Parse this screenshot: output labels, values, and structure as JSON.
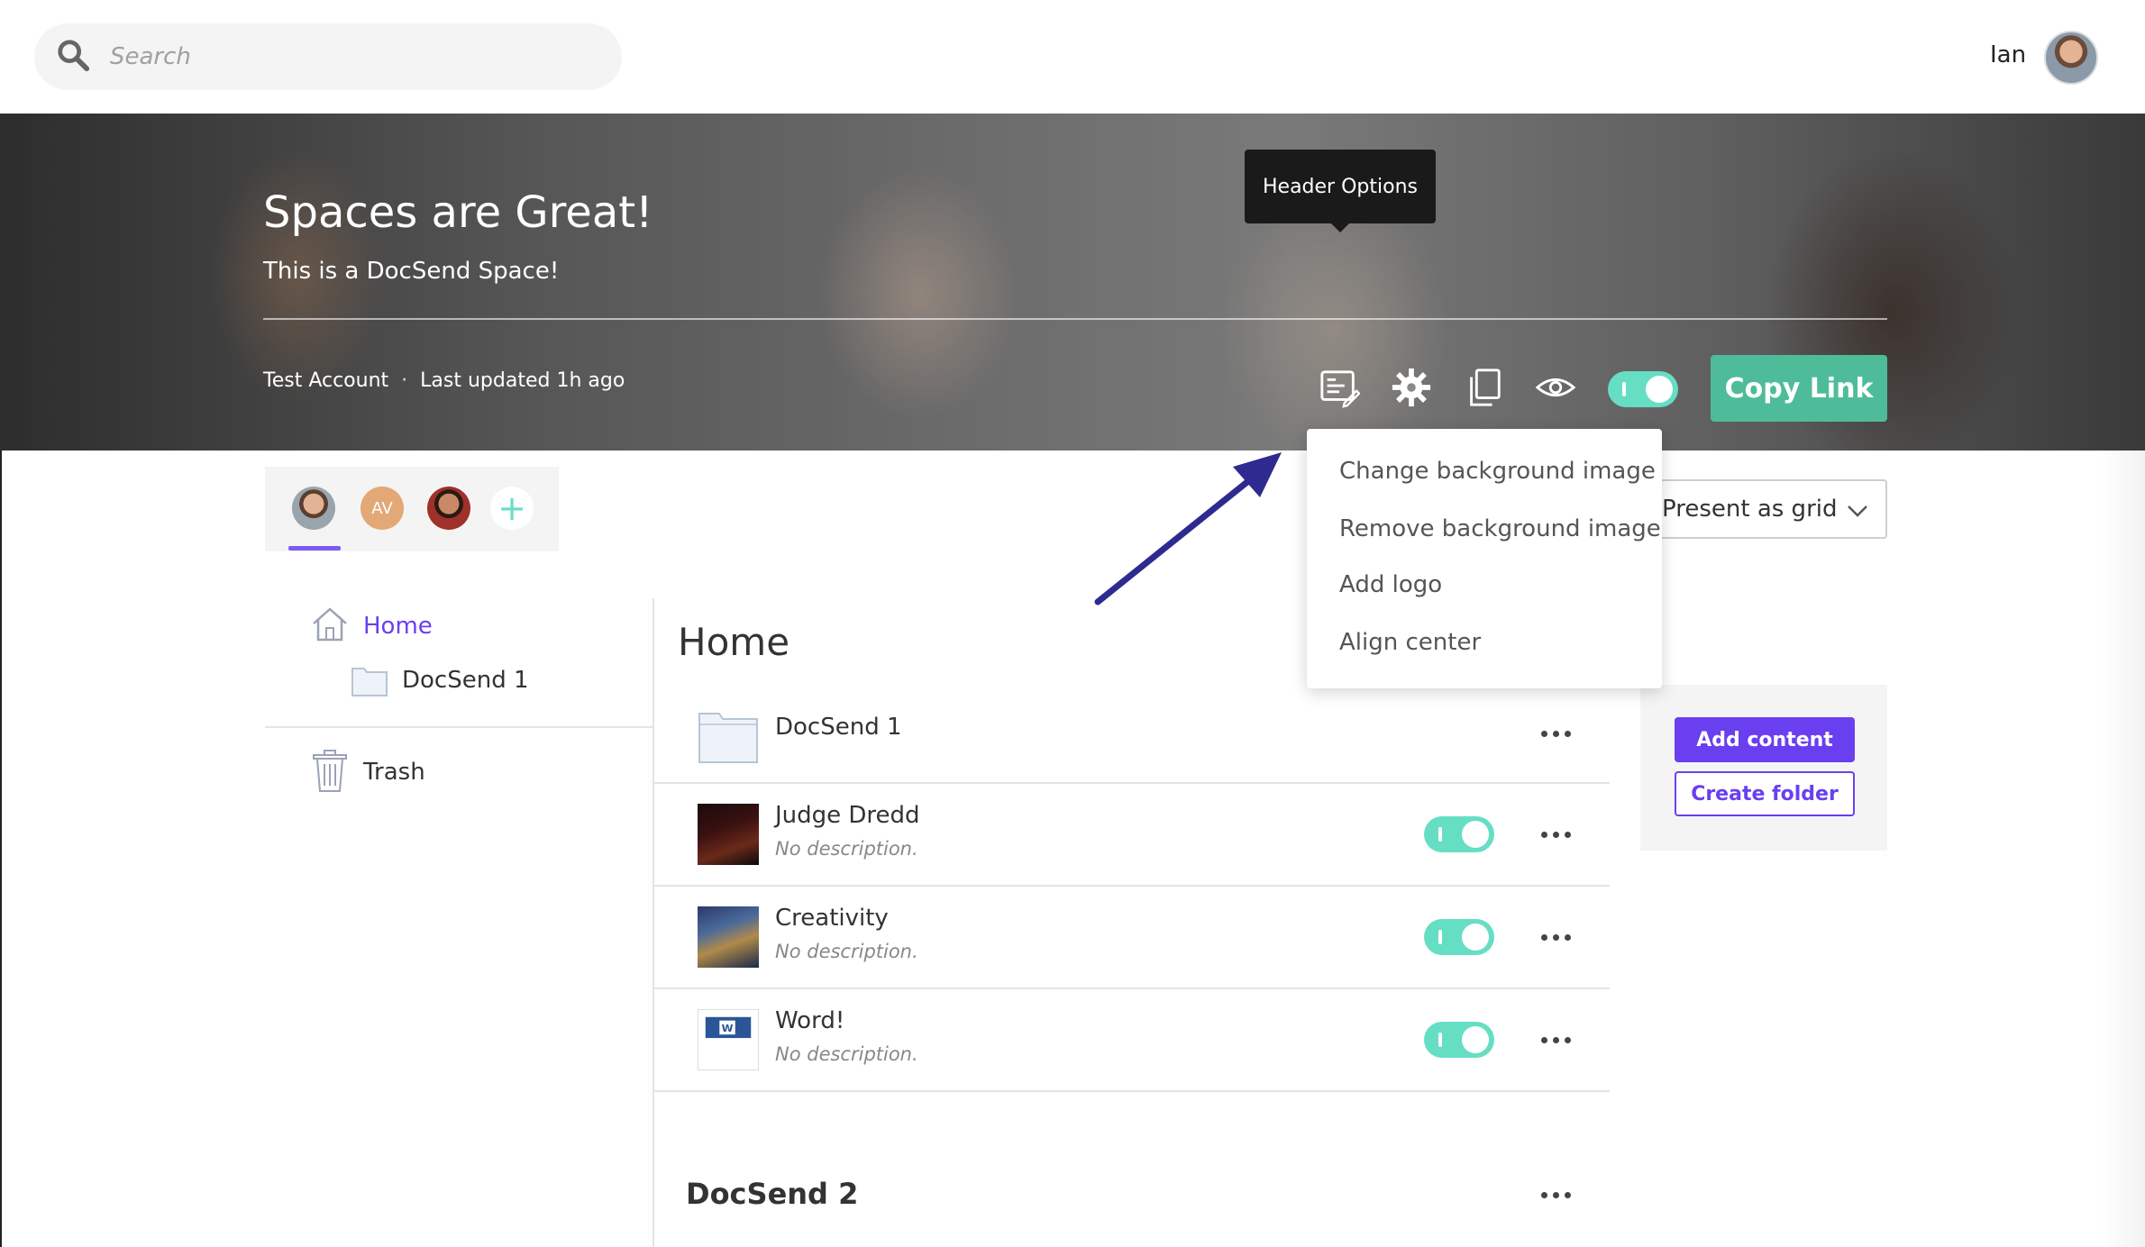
{
  "search": {
    "placeholder": "Search"
  },
  "user": {
    "name": "Ian"
  },
  "hero": {
    "title": "Spaces are Great!",
    "subtitle": "This is a DocSend Space!",
    "account": "Test Account",
    "separator": "·",
    "updated": "Last updated 1h ago",
    "tooltip": "Header Options",
    "copy_link": "Copy Link"
  },
  "members": {
    "initials": "AV",
    "add_symbol": "+"
  },
  "sidebar": {
    "home": "Home",
    "folder": "DocSend 1",
    "trash": "Trash"
  },
  "main": {
    "heading": "Home",
    "rows": [
      {
        "title": "DocSend 1",
        "description": ""
      },
      {
        "title": "Judge Dredd",
        "description": "No description."
      },
      {
        "title": "Creativity",
        "description": "No description."
      },
      {
        "title": "Word!",
        "description": "No description."
      }
    ],
    "section2": "DocSend 2"
  },
  "present": {
    "label": "Present as grid"
  },
  "panel": {
    "add_content": "Add content",
    "create_folder": "Create folder"
  },
  "dropdown": {
    "items": [
      "Change background image",
      "Remove background image",
      "Add logo",
      "Align center"
    ]
  },
  "colors": {
    "accent_purple": "#6a3ff0",
    "toggle_teal": "#66dec4",
    "copy_green": "#4fbc99",
    "arrow": "#2f2a8f"
  },
  "icons": [
    "search-icon",
    "header-options-icon",
    "gear-icon",
    "copy-icon",
    "eye-icon",
    "home-icon",
    "folder-icon",
    "trash-icon",
    "chevron-down-icon",
    "more-icon"
  ]
}
